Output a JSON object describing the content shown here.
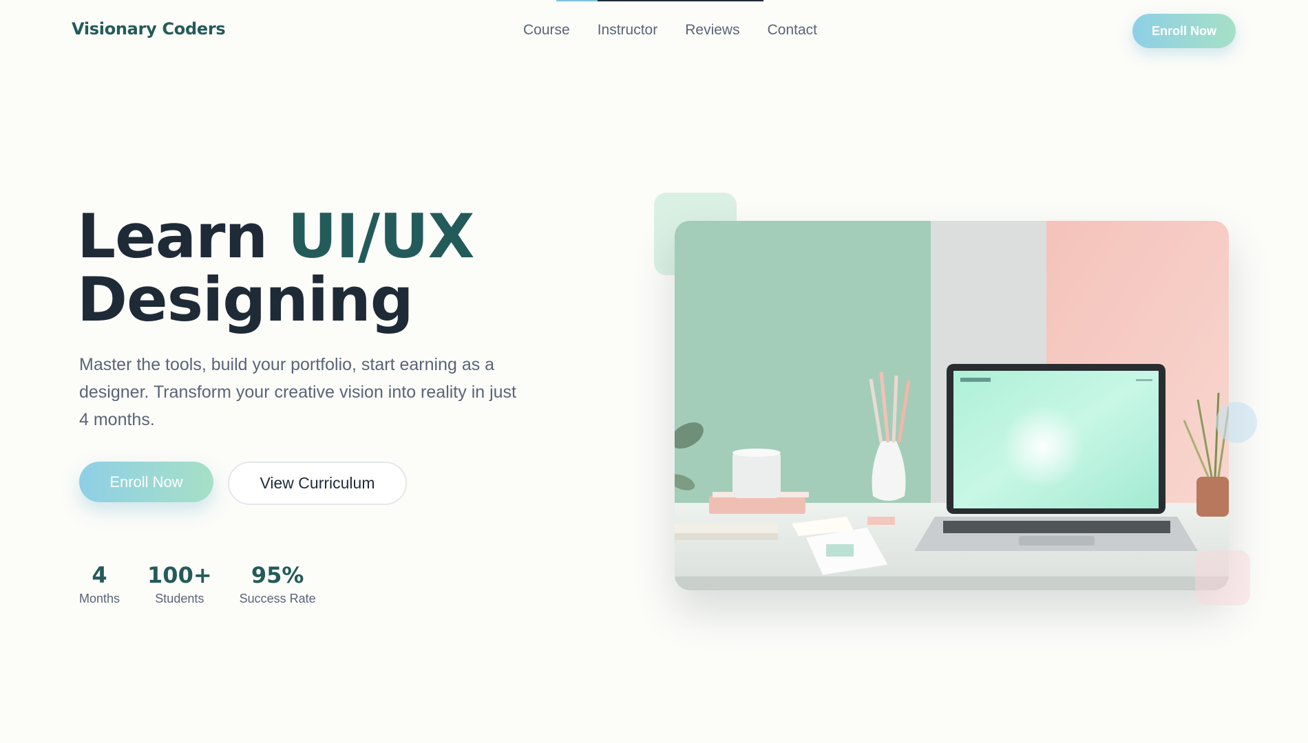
{
  "brand": {
    "name": "Visionary Coders"
  },
  "nav": {
    "items": [
      {
        "label": "Course"
      },
      {
        "label": "Instructor"
      },
      {
        "label": "Reviews"
      },
      {
        "label": "Contact"
      }
    ],
    "cta_label": "Enroll Now"
  },
  "hero": {
    "title_line1_prefix": "Learn",
    "title_line1_accent": "UI/UX",
    "title_line2": "Designing",
    "description": "Master the tools, build your portfolio, start earning as a designer. Transform your creative vision into reality in just 4 months.",
    "primary_cta": "Enroll Now",
    "secondary_cta": "View Curriculum",
    "stats": [
      {
        "value": "4",
        "label": "Months"
      },
      {
        "value": "100+",
        "label": "Students"
      },
      {
        "value": "95%",
        "label": "Success Rate"
      }
    ],
    "image_alt": "Desk workspace with laptop showing a design app"
  },
  "colors": {
    "accent": "#235b5a",
    "gradient_start": "#8ecfe6",
    "gradient_end": "#a6e0c6",
    "text_primary": "#1f2a37",
    "text_muted": "#5a6478",
    "background": "#fcfcf9"
  }
}
